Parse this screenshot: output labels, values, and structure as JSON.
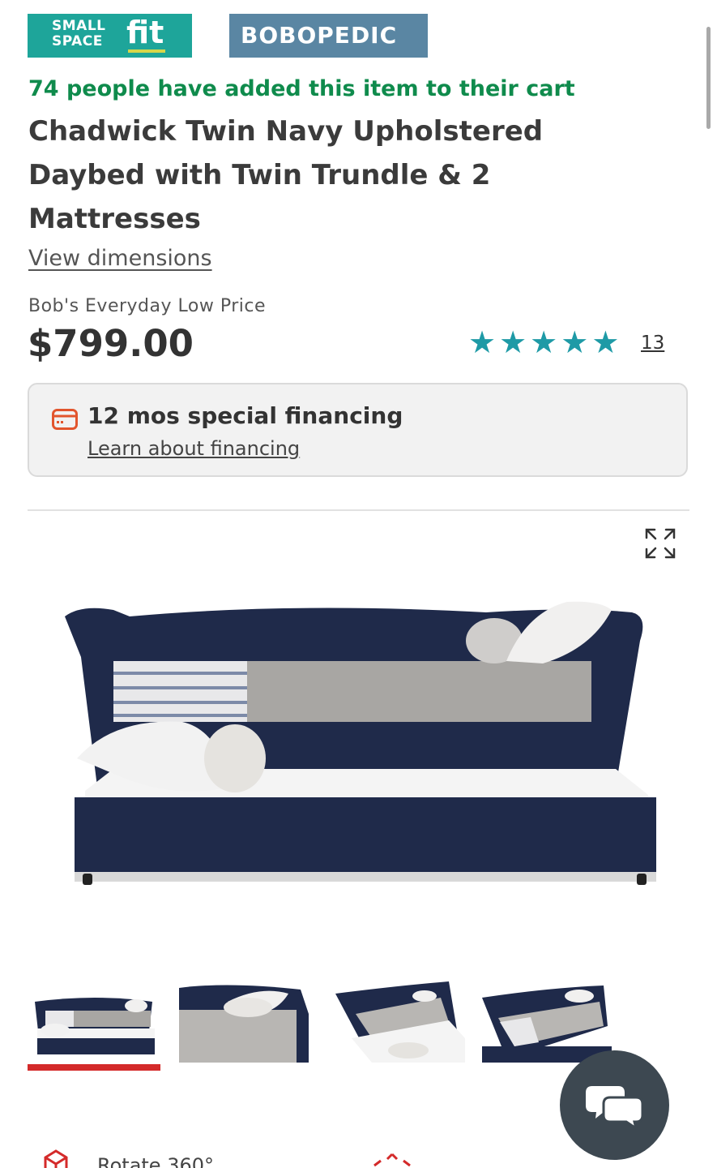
{
  "badges": {
    "small_space_line1": "SMALL",
    "small_space_line2": "SPACE",
    "small_space_fit": "fit",
    "bobopedic": "BOBOPEDIC"
  },
  "cart_message": "74 people have added this item to their cart",
  "product": {
    "title": "Chadwick Twin Navy Upholstered Daybed with Twin Trundle & 2 Mattresses",
    "view_dimensions": "View dimensions",
    "price_label": "Bob's Everyday Low Price",
    "price": "$799.00",
    "rating": 5,
    "review_count": "13"
  },
  "financing": {
    "title": "12 mos special financing",
    "link": "Learn about financing"
  },
  "gallery": {
    "thumbnail_count": 4,
    "active_index": 0
  },
  "actions": {
    "rotate_label": "Rotate 360°"
  },
  "colors": {
    "cart_green": "#0f8b4c",
    "star_teal": "#1e9aa6",
    "active_red": "#d42a2a",
    "navy": "#1f2a4a",
    "chat_bg": "#3d4851"
  }
}
